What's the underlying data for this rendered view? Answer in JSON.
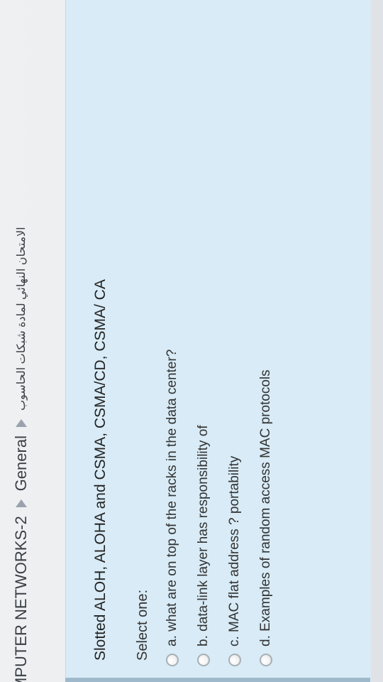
{
  "breadcrumb": {
    "course": "MPUTER NETWORKS-2",
    "section": "General",
    "exam": "الامتحان النهائي لمادة شبكات الحاسوب"
  },
  "question": {
    "text": "Slotted ALOH, ALOHA and CSMA, CSMA/CD, CSMA/ CA",
    "select_label": "Select one:",
    "options": [
      "a. what are on top of the racks in the data center?",
      "b. data-link layer has responsibility of",
      "c. MAC flat address ? portability",
      "d. Examples of random access MAC protocols"
    ]
  },
  "colors": {
    "question_bg": "#d8ebf6",
    "page_bg": "#eef0f2"
  }
}
